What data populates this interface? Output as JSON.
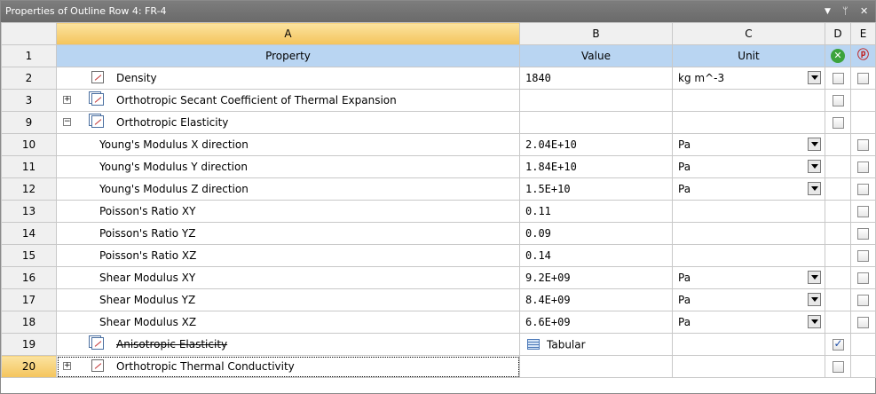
{
  "window": {
    "title": "Properties of Outline Row 4: FR-4",
    "dropdown_icon": "dropdown-arrow-icon",
    "pin_icon": "pin-icon",
    "close_icon": "close-icon"
  },
  "columns": {
    "row_header": "",
    "a": "A",
    "b": "B",
    "c": "C",
    "d": "D",
    "e": "E"
  },
  "header_row": {
    "num": "1",
    "property": "Property",
    "value": "Value",
    "unit": "Unit",
    "d_icon": "green-x-icon",
    "e_icon": "parameter-icon"
  },
  "rows": [
    {
      "num": "2",
      "label": "Density",
      "value": "1840",
      "unit": "kg m^-3"
    },
    {
      "num": "3",
      "label": "Orthotropic Secant Coefficient of Thermal Expansion",
      "expander": "+"
    },
    {
      "num": "9",
      "label": "Orthotropic Elasticity",
      "expander": "−"
    },
    {
      "num": "10",
      "label": "Young's Modulus X direction",
      "value": "2.04E+10",
      "unit": "Pa"
    },
    {
      "num": "11",
      "label": "Young's Modulus Y direction",
      "value": "1.84E+10",
      "unit": "Pa"
    },
    {
      "num": "12",
      "label": "Young's Modulus Z direction",
      "value": "1.5E+10",
      "unit": "Pa"
    },
    {
      "num": "13",
      "label": "Poisson's Ratio XY",
      "value": "0.11"
    },
    {
      "num": "14",
      "label": "Poisson's Ratio YZ",
      "value": "0.09"
    },
    {
      "num": "15",
      "label": "Poisson's Ratio XZ",
      "value": "0.14"
    },
    {
      "num": "16",
      "label": "Shear Modulus XY",
      "value": "9.2E+09",
      "unit": "Pa"
    },
    {
      "num": "17",
      "label": "Shear Modulus YZ",
      "value": "8.4E+09",
      "unit": "Pa"
    },
    {
      "num": "18",
      "label": "Shear Modulus XZ",
      "value": "6.6E+09",
      "unit": "Pa"
    },
    {
      "num": "19",
      "label": "Anisotropic Elasticity",
      "value": "Tabular"
    },
    {
      "num": "20",
      "label": "Orthotropic Thermal Conductivity",
      "expander": "+"
    }
  ],
  "colors": {
    "titlebar": "#707070",
    "header_row": "#b9d5f2",
    "selected_header": "#f4c45c"
  }
}
